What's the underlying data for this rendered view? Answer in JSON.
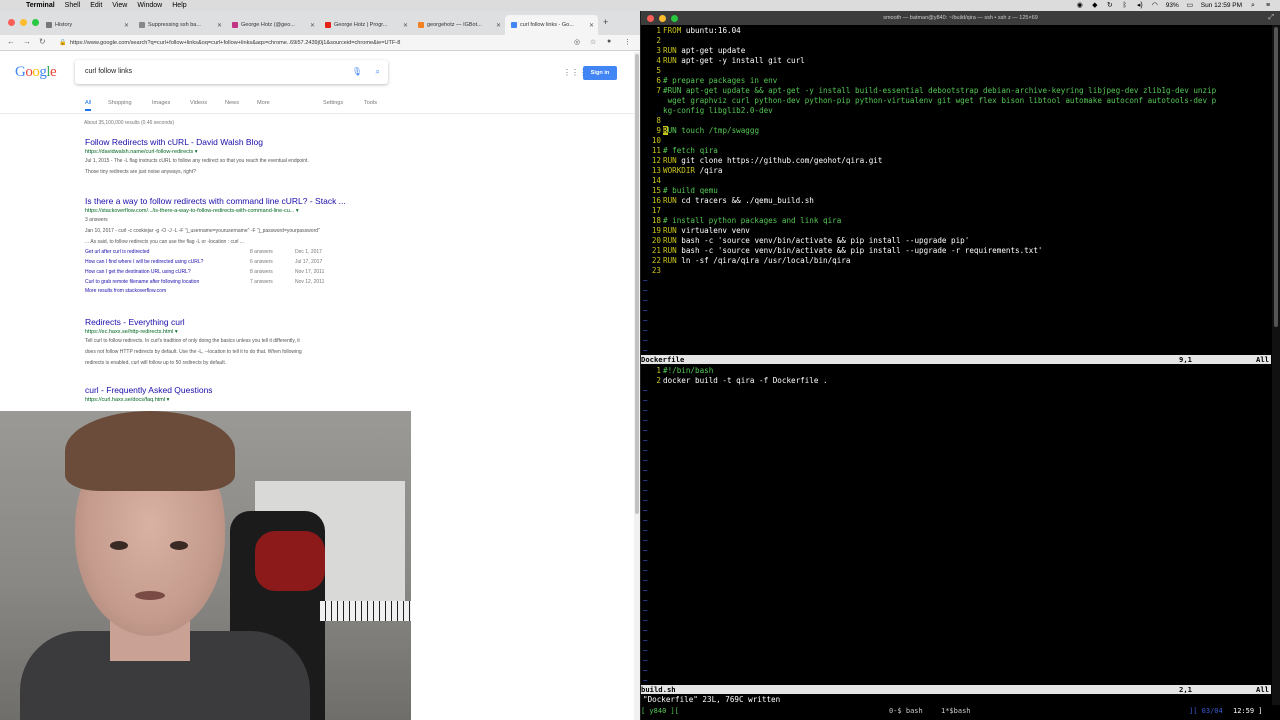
{
  "menubar": {
    "app": "Terminal",
    "items": [
      "Shell",
      "Edit",
      "View",
      "Window",
      "Help"
    ],
    "battery": "93%",
    "clock": "Sun 12:59 PM"
  },
  "browser": {
    "tabs": [
      {
        "title": "History",
        "color": "#777777"
      },
      {
        "title": "Suppressing ssh ba...",
        "color": "#888888"
      },
      {
        "title": "George Hotz (@geo...",
        "color": "#c13584"
      },
      {
        "title": "George Hotz | Progr...",
        "color": "#e62117"
      },
      {
        "title": "georgehotz — IGBot...",
        "color": "#f48024"
      },
      {
        "title": "curl follow links - Go...",
        "color": "#4285f4"
      }
    ],
    "url": "https://www.google.com/search?q=curl+follow+links&oq=curl+follow+links&aqs=chrome..69i57.2439j0j1&sourceid=chrome&ie=UTF-8",
    "google": {
      "logo": "Google",
      "query": "curl follow links",
      "sign_in": "Sign in",
      "tabs": [
        "All",
        "Shopping",
        "Images",
        "Videos",
        "News",
        "More"
      ],
      "tools": [
        "Settings",
        "Tools"
      ],
      "stats": "About 35,100,000 results (0.46 seconds)",
      "results": [
        {
          "title": "Follow Redirects with cURL - David Walsh Blog",
          "url": "https://davidwalsh.name/curl-follow-redirects ▾",
          "snippet": [
            "Jul 1, 2015 - The -L flag instructs cURL to follow any redirect so that you reach the eventual endpoint.",
            "Those tiny redirects are just noise anyways, right?"
          ]
        },
        {
          "title": "Is there a way to follow redirects with command line cURL? - Stack ...",
          "url": "https://stackoverflow.com/.../is-there-a-way-to-follow-redirects-with-command-line-cu... ▾",
          "snippet": [
            "3 answers",
            "Jan 10, 2017 - curl -c cookiejar -g -O -J -L -F \"j_username=yourusername\" -F \"j_password=yourpassword\"",
            "... As said, to follow redirects you can use the flag -L or -location : curl ..."
          ],
          "sublinks": [
            {
              "q": "Get url after curl is redirected",
              "n": "8 answers",
              "d": "Dec 1, 2017"
            },
            {
              "q": "How can I find where I will be redirected using cURL?",
              "n": "6 answers",
              "d": "Jul 17, 2017"
            },
            {
              "q": "How can I get the destination URL using cURL?",
              "n": "8 answers",
              "d": "Nov 17, 2011"
            },
            {
              "q": "Curl to grab remote filename after following location",
              "n": "7 answers",
              "d": "Nov 12, 2011"
            }
          ],
          "more": "More results from stackoverflow.com"
        },
        {
          "title": "Redirects - Everything curl",
          "url": "https://ec.haxx.se/http-redirects.html ▾",
          "snippet": [
            "Tell curl to follow redirects. In curl's tradition of only doing the basics unless you tell it differently, it",
            "does not follow HTTP redirects by default. Use the -L, --location to tell it to do that. When following",
            "redirects is enabled, curl will follow up to 50 redirects by default."
          ]
        },
        {
          "title": "curl - Frequently Asked Questions",
          "url": "https://curl.haxx.se/docs/faq.html ▾",
          "snippet": []
        }
      ]
    }
  },
  "terminal": {
    "title": "smooth — batman@y840: ~/build/qira — ssh • ssh z — 125×69",
    "dockerfile": [
      {
        "n": "1",
        "parts": [
          [
            "kw",
            "FROM"
          ],
          [
            "tx",
            " ubuntu:16.04"
          ]
        ]
      },
      {
        "n": "2",
        "parts": []
      },
      {
        "n": "3",
        "parts": [
          [
            "kw",
            "RUN"
          ],
          [
            "tx",
            " apt-get update"
          ]
        ]
      },
      {
        "n": "4",
        "parts": [
          [
            "kw",
            "RUN"
          ],
          [
            "tx",
            " apt-get -y install git curl"
          ]
        ]
      },
      {
        "n": "5",
        "parts": []
      },
      {
        "n": "6",
        "parts": [
          [
            "cmt",
            "# prepare packages in env"
          ]
        ]
      },
      {
        "n": "7",
        "parts": [
          [
            "cmt",
            "#RUN apt-get update && apt-get -y install build-essential debootstrap debian-archive-keyring libjpeg-dev zlib1g-dev unzip"
          ]
        ]
      },
      {
        "n": "",
        "parts": [
          [
            "cmt",
            " wget graphviz curl python-dev python-pip python-virtualenv git wget flex bison libtool automake autoconf autotools-dev p"
          ]
        ]
      },
      {
        "n": "",
        "parts": [
          [
            "cmt",
            "kg-config libglib2.0-dev"
          ]
        ]
      },
      {
        "n": "8",
        "parts": []
      },
      {
        "n": "9",
        "parts": [
          [
            "cur",
            "R"
          ],
          [
            "cmt",
            "UN touch /tmp/swaggg"
          ]
        ]
      },
      {
        "n": "10",
        "parts": []
      },
      {
        "n": "11",
        "parts": [
          [
            "cmt",
            "# fetch qira"
          ]
        ]
      },
      {
        "n": "12",
        "parts": [
          [
            "kw",
            "RUN"
          ],
          [
            "tx",
            " git clone https://github.com/geohot/qira.git"
          ]
        ]
      },
      {
        "n": "13",
        "parts": [
          [
            "kw",
            "WORKDIR"
          ],
          [
            "tx",
            " /qira"
          ]
        ]
      },
      {
        "n": "14",
        "parts": []
      },
      {
        "n": "15",
        "parts": [
          [
            "cmt",
            "# build qemu"
          ]
        ]
      },
      {
        "n": "16",
        "parts": [
          [
            "kw",
            "RUN"
          ],
          [
            "tx",
            " cd tracers && ./qemu_build.sh"
          ]
        ]
      },
      {
        "n": "17",
        "parts": []
      },
      {
        "n": "18",
        "parts": [
          [
            "cmt",
            "# install python packages and link qira"
          ]
        ]
      },
      {
        "n": "19",
        "parts": [
          [
            "kw",
            "RUN"
          ],
          [
            "tx",
            " virtualenv venv"
          ]
        ]
      },
      {
        "n": "20",
        "parts": [
          [
            "kw",
            "RUN"
          ],
          [
            "tx",
            " bash -c 'source venv/bin/activate && pip install --upgrade pip'"
          ]
        ]
      },
      {
        "n": "21",
        "parts": [
          [
            "kw",
            "RUN"
          ],
          [
            "tx",
            " bash -c 'source venv/bin/activate && pip install --upgrade -r requirements.txt'"
          ]
        ]
      },
      {
        "n": "22",
        "parts": [
          [
            "kw",
            "RUN"
          ],
          [
            "tx",
            " ln -sf /qira/qira /usr/local/bin/qira"
          ]
        ]
      },
      {
        "n": "23",
        "parts": []
      }
    ],
    "status1": {
      "file": "Dockerfile",
      "pos": "9,1",
      "all": "All"
    },
    "buildsh": [
      {
        "n": "1",
        "parts": [
          [
            "cmt",
            "#!/bin/bash"
          ]
        ]
      },
      {
        "n": "2",
        "parts": [
          [
            "tx",
            "docker build -t qira -f Dockerfile ."
          ]
        ]
      }
    ],
    "status2": {
      "file": "build.sh",
      "pos": "2,1",
      "all": "All"
    },
    "message": "\"Dockerfile\" 23L, 769C written",
    "tmux": {
      "session": "[ y840 ][",
      "win0": "0-$ bash",
      "win1": "1*$bash",
      "date": "][ 03/04",
      "time": "12:59 ]"
    }
  }
}
